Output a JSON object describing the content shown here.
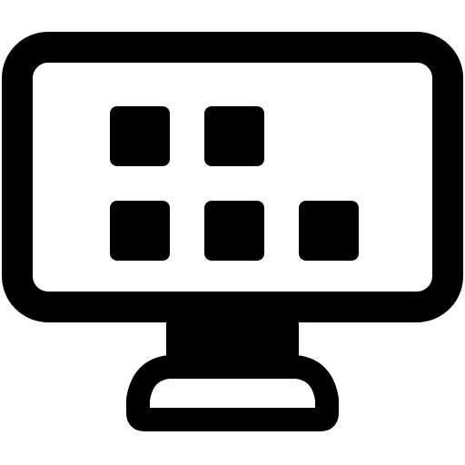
{
  "icon": {
    "name": "desktop-monitor-apps-icon",
    "screen_tiles": [
      {
        "name": "app-tile-1"
      },
      {
        "name": "app-tile-2"
      },
      {
        "name": "app-tile-3"
      },
      {
        "name": "app-tile-4"
      },
      {
        "name": "app-tile-5"
      }
    ],
    "colors": {
      "stroke": "#000000",
      "fill": "#000000",
      "background": "#ffffff"
    }
  }
}
